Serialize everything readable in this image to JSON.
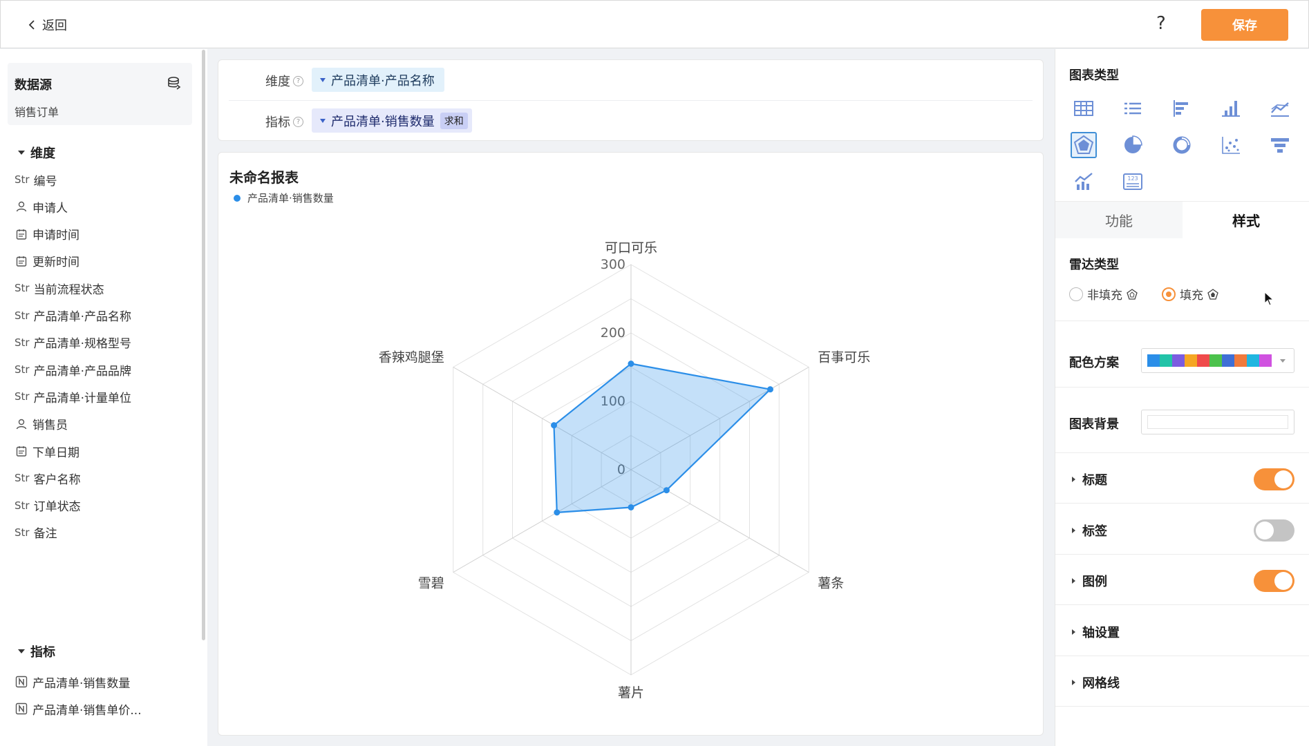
{
  "topbar": {
    "back_label": "返回",
    "help_label": "?",
    "save_label": "保存"
  },
  "left": {
    "datasource_title": "数据源",
    "datasource_name": "销售订单",
    "dimensions_header": "维度",
    "dimensions": [
      {
        "type": "Str",
        "label": "编号"
      },
      {
        "type": "person-icon",
        "label": "申请人"
      },
      {
        "type": "date-icon",
        "label": "申请时间"
      },
      {
        "type": "date-icon",
        "label": "更新时间"
      },
      {
        "type": "Str",
        "label": "当前流程状态"
      },
      {
        "type": "Str",
        "label": "产品清单·产品名称"
      },
      {
        "type": "Str",
        "label": "产品清单·规格型号"
      },
      {
        "type": "Str",
        "label": "产品清单·产品品牌"
      },
      {
        "type": "Str",
        "label": "产品清单·计量单位"
      },
      {
        "type": "person-icon",
        "label": "销售员"
      },
      {
        "type": "date-icon",
        "label": "下单日期"
      },
      {
        "type": "Str",
        "label": "客户名称"
      },
      {
        "type": "Str",
        "label": "订单状态"
      },
      {
        "type": "Str",
        "label": "备注"
      }
    ],
    "measures_header": "指标",
    "measures": [
      {
        "type": "number-icon",
        "label": "产品清单·销售数量"
      },
      {
        "type": "number-icon",
        "label": "产品清单·销售单价..."
      }
    ]
  },
  "config": {
    "dimension_label": "维度",
    "dimension_value": "产品清单·产品名称",
    "measure_label": "指标",
    "measure_value": "产品清单·销售数量",
    "measure_agg": "求和"
  },
  "chart_card": {
    "title": "未命名报表"
  },
  "chart_data": {
    "type": "radar",
    "title": "未命名报表",
    "fill": true,
    "axis_ticks": [
      "300",
      "200",
      "100",
      "0"
    ],
    "range": [
      0,
      300
    ],
    "categories": [
      "可口可乐",
      "百事可乐",
      "薯条",
      "薯片",
      "雪碧",
      "香辣鸡腿堡"
    ],
    "series": [
      {
        "name": "产品清单·销售数量",
        "values": [
          155,
          235,
          60,
          55,
          125,
          130
        ],
        "color": "#2b8ee8"
      }
    ]
  },
  "right": {
    "chart_type_title": "图表类型",
    "chart_types": [
      "table-icon",
      "list-icon",
      "bar-horizontal-icon",
      "bar-vertical-icon",
      "line-icon",
      "radar-icon",
      "pie-icon",
      "donut-icon",
      "scatter-icon",
      "funnel-icon",
      "combo-icon",
      "number-card-icon"
    ],
    "active_chart_type": "radar-icon",
    "tab_function": "功能",
    "tab_style": "样式",
    "radar_type_label": "雷达类型",
    "radar_option_unfilled": "非填充",
    "radar_option_filled": "填充",
    "palette_label": "配色方案",
    "palette_colors": [
      "#2b8ee8",
      "#22c3a8",
      "#7b5ce0",
      "#f5a623",
      "#ef4b4b",
      "#4cc24c",
      "#3f6fd6",
      "#f07a3c",
      "#20b6e0",
      "#d052e0"
    ],
    "bg_label": "图表背景",
    "sections": [
      {
        "label": "标题",
        "toggle": true
      },
      {
        "label": "标签",
        "toggle": false
      },
      {
        "label": "图例",
        "toggle": true
      },
      {
        "label": "轴设置",
        "toggle": null
      },
      {
        "label": "网格线",
        "toggle": null
      }
    ]
  }
}
